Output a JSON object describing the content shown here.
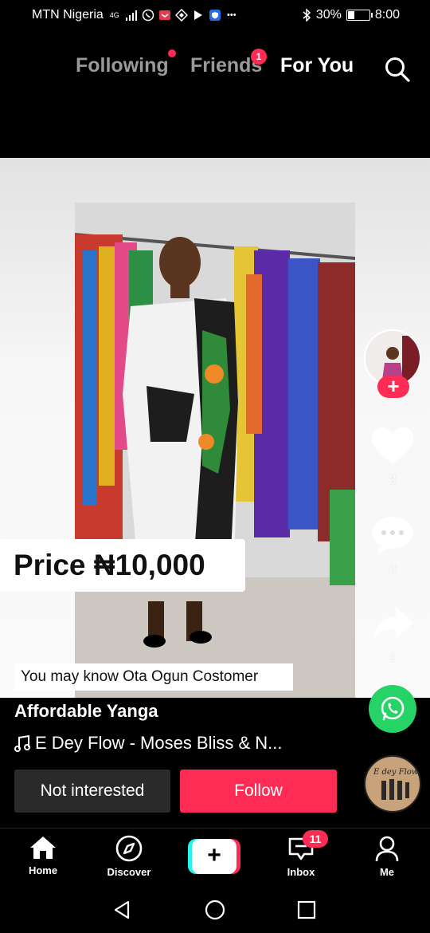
{
  "status_bar": {
    "carrier": "MTN Nigeria",
    "network": "4G",
    "battery_percent": "30%",
    "battery_level": 0.3,
    "time": "8:00"
  },
  "top_nav": {
    "tabs": [
      {
        "label": "Following"
      },
      {
        "label": "Friends",
        "badge": "1"
      },
      {
        "label": "For You"
      }
    ],
    "active_tab": "For You"
  },
  "video": {
    "price_text": "Price ₦10,000",
    "suggestion_text": "You may know Ota Ogun Costomer"
  },
  "side_actions": {
    "likes": "3",
    "comments": "0",
    "shares": "1"
  },
  "caption": {
    "username": "Affordable Yanga",
    "music": "E Dey Flow - Moses Bliss & N...",
    "disc_text": "E dey Flow"
  },
  "buttons": {
    "not_interested": "Not interested",
    "follow": "Follow"
  },
  "bottom_nav": {
    "home": "Home",
    "discover": "Discover",
    "create": "+",
    "inbox": "Inbox",
    "inbox_badge": "11",
    "me": "Me"
  },
  "colors": {
    "accent": "#fe2c55",
    "whatsapp": "#25d366",
    "cyan": "#25f4ee"
  }
}
